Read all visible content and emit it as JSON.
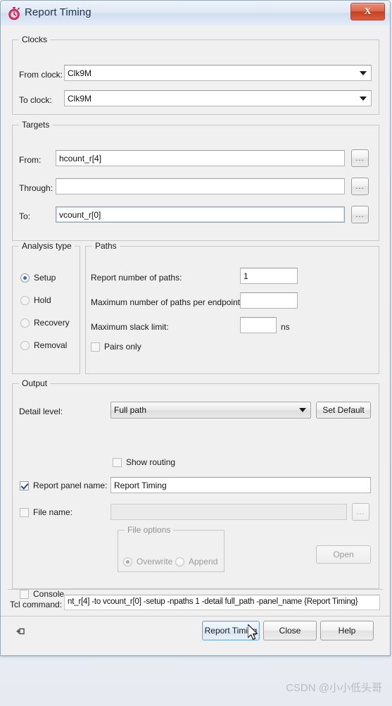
{
  "window": {
    "title": "Report Timing",
    "icon": "stopwatch-icon",
    "close_label": "X"
  },
  "clocks": {
    "legend": "Clocks",
    "from_clock_label": "From clock:",
    "from_clock_value": "Clk9M",
    "to_clock_label": "To clock:",
    "to_clock_value": "Clk9M"
  },
  "targets": {
    "legend": "Targets",
    "from_label": "From:",
    "from_value": "hcount_r[4]",
    "through_label": "Through:",
    "through_value": "",
    "to_label": "To:",
    "to_value": "vcount_r[0]",
    "browse_label": "..."
  },
  "analysis": {
    "legend": "Analysis type",
    "options": [
      {
        "label": "Setup",
        "selected": true
      },
      {
        "label": "Hold",
        "selected": false
      },
      {
        "label": "Recovery",
        "selected": false
      },
      {
        "label": "Removal",
        "selected": false
      }
    ]
  },
  "paths": {
    "legend": "Paths",
    "report_number_label": "Report number of paths:",
    "report_number_value": "1",
    "max_per_endpoint_label": "Maximum number of paths per endpoint:",
    "max_per_endpoint_value": "",
    "max_slack_label": "Maximum slack limit:",
    "max_slack_value": "",
    "max_slack_unit": "ns",
    "pairs_only_label": "Pairs only",
    "pairs_only_checked": false
  },
  "output": {
    "legend": "Output",
    "detail_level_label": "Detail level:",
    "detail_level_value": "Full path",
    "set_default_label": "Set Default",
    "show_routing_label": "Show routing",
    "show_routing_checked": false,
    "report_panel_label": "Report panel name:",
    "report_panel_checked": true,
    "report_panel_value": "Report Timing",
    "file_name_label": "File name:",
    "file_name_checked": false,
    "file_name_value": "",
    "file_browse_label": "...",
    "file_options_legend": "File options",
    "overwrite_label": "Overwrite",
    "overwrite_selected": true,
    "append_label": "Append",
    "append_selected": false,
    "open_label": "Open",
    "console_label": "Console",
    "console_checked": false
  },
  "tcl": {
    "label": "Tcl command:",
    "value": "nt_r[4] -to vcount_r[0] -setup -npaths 1 -detail full_path -panel_name {Report Timing}"
  },
  "footer": {
    "pin_icon": "pin-icon",
    "report_timing_label": "Report Timing",
    "close_label": "Close",
    "help_label": "Help"
  },
  "watermark": {
    "text": "CSDN @小小低头哥"
  },
  "colors": {
    "accent": "#2f6fb5",
    "close_red": "#c63f21",
    "dialog_bg": "#f0f0f0",
    "group_border": "#c8c8c8"
  }
}
